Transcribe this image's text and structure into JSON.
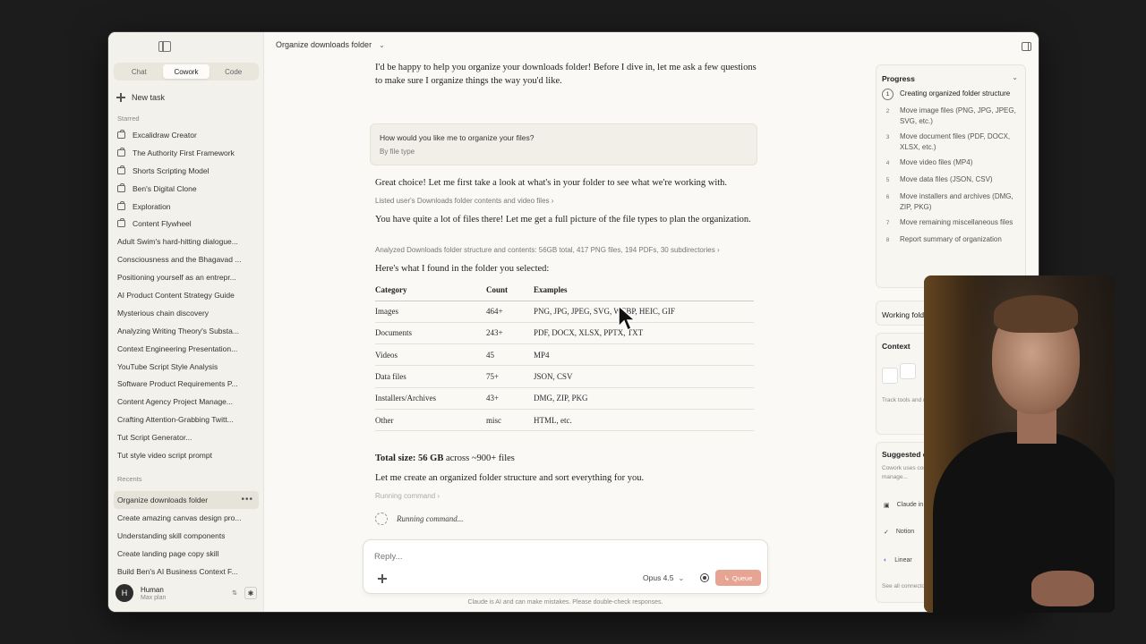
{
  "sidebar": {
    "tabs": [
      {
        "label": "Chat",
        "active": false
      },
      {
        "label": "Cowork",
        "active": true
      },
      {
        "label": "Code",
        "active": false
      }
    ],
    "new_task": "New task",
    "starred_label": "Starred",
    "starred": [
      "Excalidraw Creator",
      "The Authority First Framework",
      "Shorts Scripting Model",
      "Ben's Digital Clone",
      "Exploration",
      "Content Flywheel",
      "Adult Swim's hard-hitting dialogue...",
      "Consciousness and the Bhagavad ...",
      "Positioning yourself as an entrepr...",
      "AI Product Content Strategy Guide",
      "Mysterious chain discovery",
      "Analyzing Writing Theory's Substa...",
      "Context Engineering Presentation...",
      "YouTube Script Style Analysis",
      "Software Product Requirements P...",
      "Content Agency Project Manage...",
      "Crafting Attention-Grabbing Twitt...",
      "Tut Script Generator...",
      "Tut style video script prompt"
    ],
    "recents_label": "Recents",
    "recents": [
      "Organize downloads folder",
      "Create amazing canvas design pro...",
      "Understanding skill components",
      "Create landing page copy skill",
      "Build Ben's AI Business Context F..."
    ],
    "user": {
      "initial": "H",
      "name": "Human",
      "plan": "Max plan"
    }
  },
  "header": {
    "title": "Organize downloads folder"
  },
  "chat": {
    "intro": "I'd be happy to help you organize your downloads folder! Before I dive in, let me ask a few questions to make sure I organize things the way you'd like.",
    "question": "How would you like me to organize your files?",
    "answer": "By file type",
    "msg2": "Great choice! Let me first take a look at what's in your folder to see what we're working with.",
    "tool1": "Listed user's Downloads folder contents and video files",
    "msg3": "You have quite a lot of files there! Let me get a full picture of the file types to plan the organization.",
    "tool2": "Analyzed Downloads folder structure and contents: 56GB total, 417 PNG files, 194 PDFs, 30 subdirectories",
    "msg4": "Here's what I found in the folder you selected:",
    "table": {
      "headers": [
        "Category",
        "Count",
        "Examples"
      ],
      "rows": [
        [
          "Images",
          "464+",
          "PNG, JPG, JPEG, SVG, WEBP, HEIC, GIF"
        ],
        [
          "Documents",
          "243+",
          "PDF, DOCX, XLSX, PPTX, TXT"
        ],
        [
          "Videos",
          "45",
          "MP4"
        ],
        [
          "Data files",
          "75+",
          "JSON, CSV"
        ],
        [
          "Installers/Archives",
          "43+",
          "DMG, ZIP, PKG"
        ],
        [
          "Other",
          "misc",
          "HTML, etc."
        ]
      ]
    },
    "total_bold": "Total size: 56 GB",
    "total_rest": " across ~900+ files",
    "msg5": "Let me create an organized folder structure and sort everything for you.",
    "tool3": "Running command",
    "running": "Running command..."
  },
  "composer": {
    "placeholder": "Reply...",
    "model": "Opus 4.5",
    "queue_label": "Queue",
    "disclaimer": "Claude is AI and can make mistakes. Please double-check responses."
  },
  "progress": {
    "title": "Progress",
    "steps": [
      "Creating organized folder structure",
      "Move image files (PNG, JPG, JPEG, SVG, etc.)",
      "Move document files (PDF, DOCX, XLSX, etc.)",
      "Move video files (MP4)",
      "Move data files (JSON, CSV)",
      "Move installers and archives (DMG, ZIP, PKG)",
      "Move remaining miscellaneous files",
      "Report summary of organization"
    ],
    "step_numbers": [
      "1",
      "2",
      "3",
      "4",
      "5",
      "6",
      "7",
      "8"
    ],
    "current_step": 1
  },
  "right": {
    "working_folder": "Working folder",
    "context_title": "Context",
    "context_desc": "Track tools and referenced files used in this task.",
    "suggested_title": "Suggested connectors",
    "suggested_desc": "Cowork uses connectors to browse websites, manage...",
    "connectors": [
      "Claude in Chrome",
      "Notion",
      "Linear"
    ],
    "see_all": "See all connectors"
  },
  "icons": {
    "sidebar_toggle": "sidebar-toggle-icon",
    "starred_item": "bag-icon",
    "panel_toggle": "panel-toggle-icon",
    "cursor": "mouse-pointer"
  },
  "colors": {
    "accent": "#e8a493",
    "background": "#faf9f5",
    "sidebar": "#f3f1eb"
  }
}
